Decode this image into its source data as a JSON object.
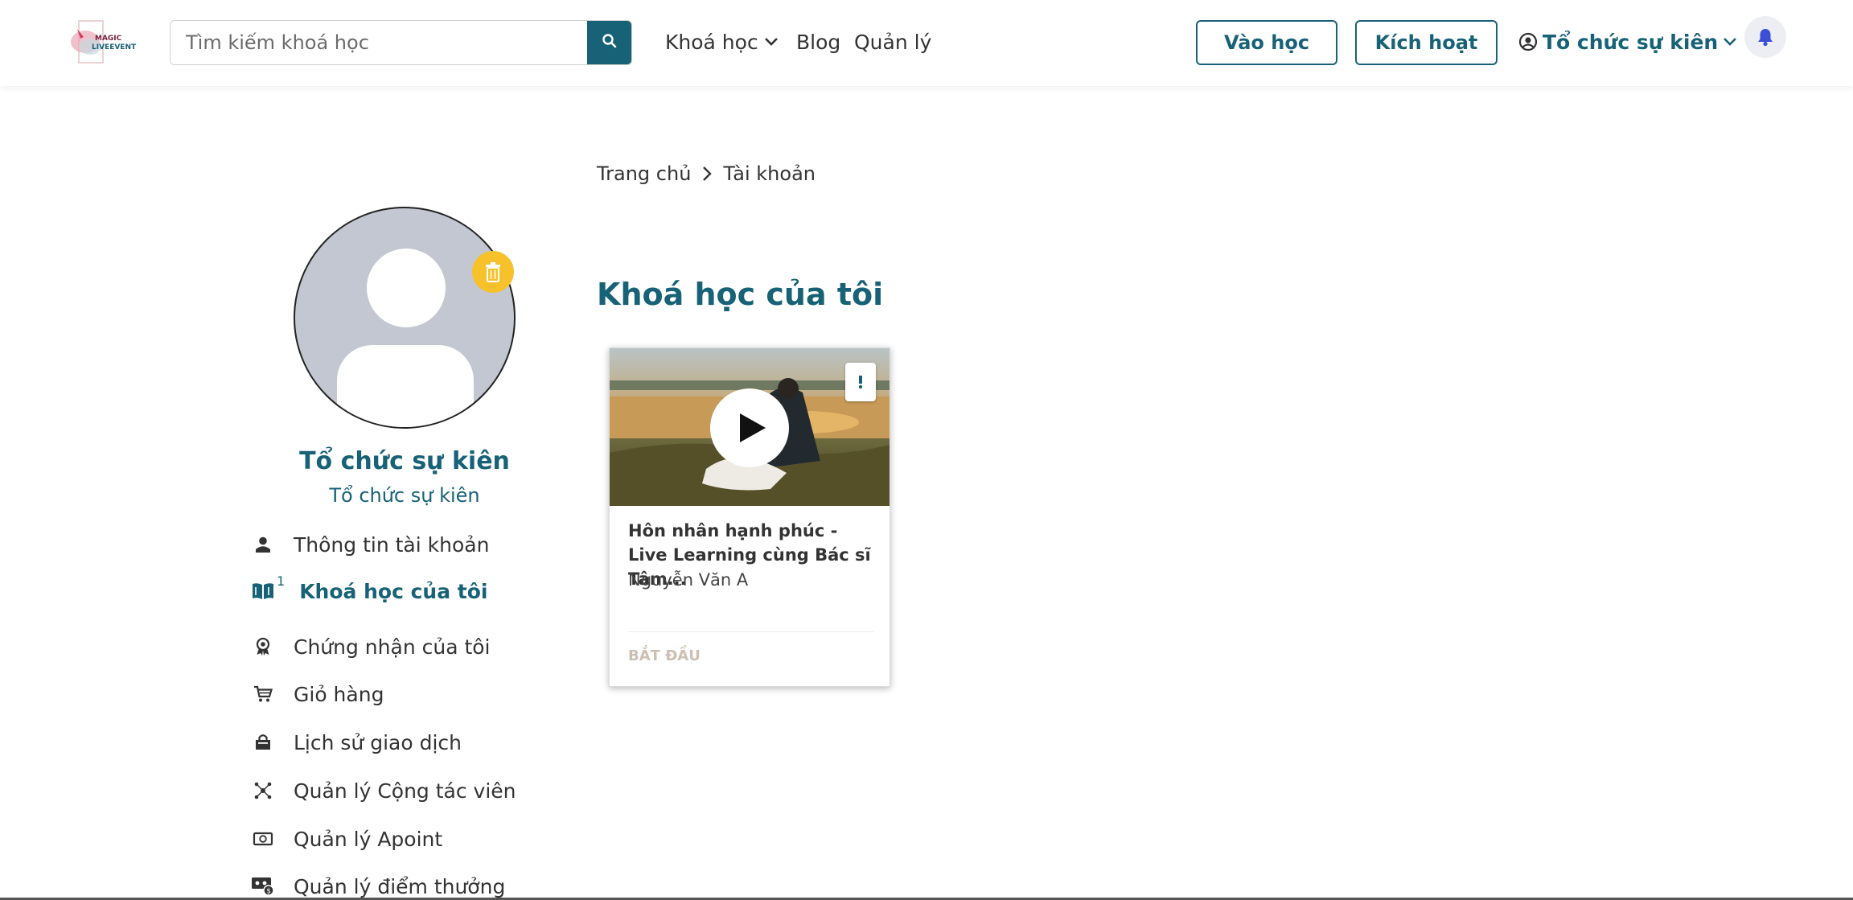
{
  "header": {
    "logo_text_top": "MAGIC",
    "logo_text_bottom": "LIVEEVENT",
    "search_placeholder": "Tìm kiếm khoá học",
    "nav": {
      "courses": "Khoá học",
      "blog": "Blog",
      "manage": "Quản lý"
    },
    "enter_class": "Vào học",
    "activate": "Kích hoạt",
    "user_name": "Tổ chức sự kiên"
  },
  "profile": {
    "name": "Tổ chức sự kiên",
    "role": "Tổ chức sự kiên"
  },
  "sidebar": {
    "items": [
      {
        "label": "Thông tin tài khoản",
        "icon": "user-icon"
      },
      {
        "label": "Khoá học của tôi",
        "icon": "book-icon",
        "badge": "1",
        "active": true
      },
      {
        "label": "Chứng nhận của tôi",
        "icon": "award-icon"
      },
      {
        "label": "Giỏ hàng",
        "icon": "cart-icon"
      },
      {
        "label": "Lịch sử giao dịch",
        "icon": "shopping-bag-icon"
      },
      {
        "label": "Quản lý Cộng tác viên",
        "icon": "network-icon"
      },
      {
        "label": "Quản lý Apoint",
        "icon": "money-icon"
      },
      {
        "label": "Quản lý điểm thưởng",
        "icon": "reward-points-icon"
      }
    ]
  },
  "breadcrumb": {
    "home": "Trang chủ",
    "current": "Tài khoản"
  },
  "main": {
    "title": "Khoá học của tôi",
    "courses": [
      {
        "title": "Hôn nhân hạnh phúc - Live Learning cùng Bác sĩ Tâm...",
        "author": "Nguyễn Văn A",
        "action": "BẮT ĐẦU"
      }
    ]
  },
  "colors": {
    "primary": "#176277",
    "accent_yellow": "#f6c12a",
    "avatar_bg": "#c2c7d1",
    "bell_icon": "#3b4fd6"
  }
}
